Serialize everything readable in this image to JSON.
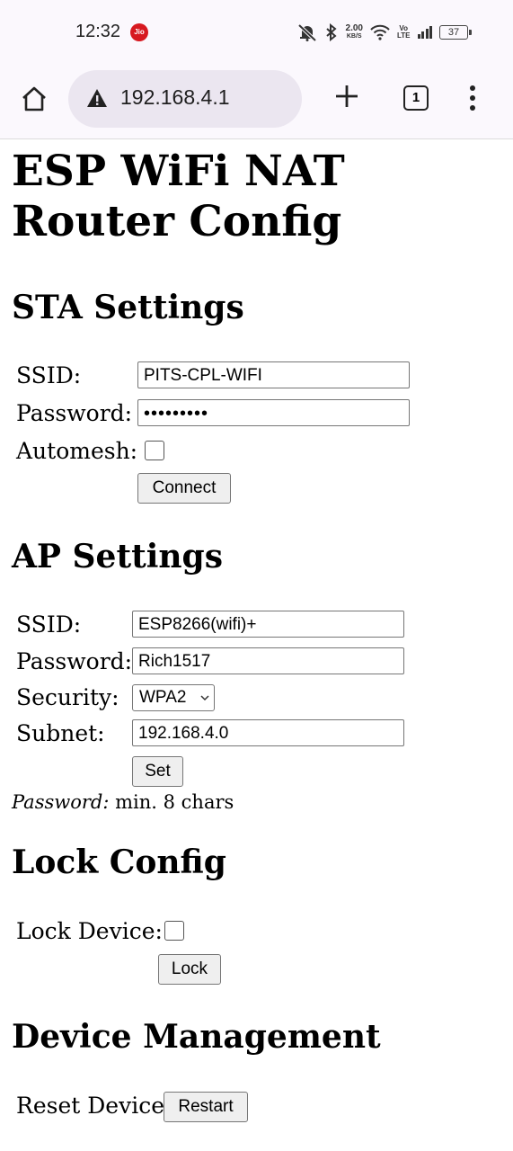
{
  "status_bar": {
    "time": "12:32",
    "carrier_badge": "Jio",
    "net_speed_value": "2.00",
    "net_speed_unit": "KB/S",
    "volte_top": "Vo",
    "volte_bottom": "LTE",
    "battery": "37"
  },
  "browser": {
    "url": "192.168.4.1",
    "tab_count": "1"
  },
  "page": {
    "title": "ESP WiFi NAT Router Config",
    "sta": {
      "heading": "STA Settings",
      "ssid_label": "SSID:",
      "ssid_value": "PITS-CPL-WIFI",
      "password_label": "Password:",
      "password_value": "•••••••••",
      "automesh_label": "Automesh:",
      "connect_label": "Connect"
    },
    "ap": {
      "heading": "AP Settings",
      "ssid_label": "SSID:",
      "ssid_value": "ESP8266(wifi)+",
      "password_label": "Password:",
      "password_value": "Rich1517",
      "security_label": "Security:",
      "security_value": "WPA2",
      "subnet_label": "Subnet:",
      "subnet_value": "192.168.4.0",
      "set_label": "Set",
      "note_em": "Password:",
      "note_text": " min. 8 chars"
    },
    "lock": {
      "heading": "Lock Config",
      "lock_label": "Lock Device:",
      "lock_button": "Lock"
    },
    "device": {
      "heading": "Device Management",
      "reset_label": "Reset Device:",
      "restart_button": "Restart"
    }
  }
}
